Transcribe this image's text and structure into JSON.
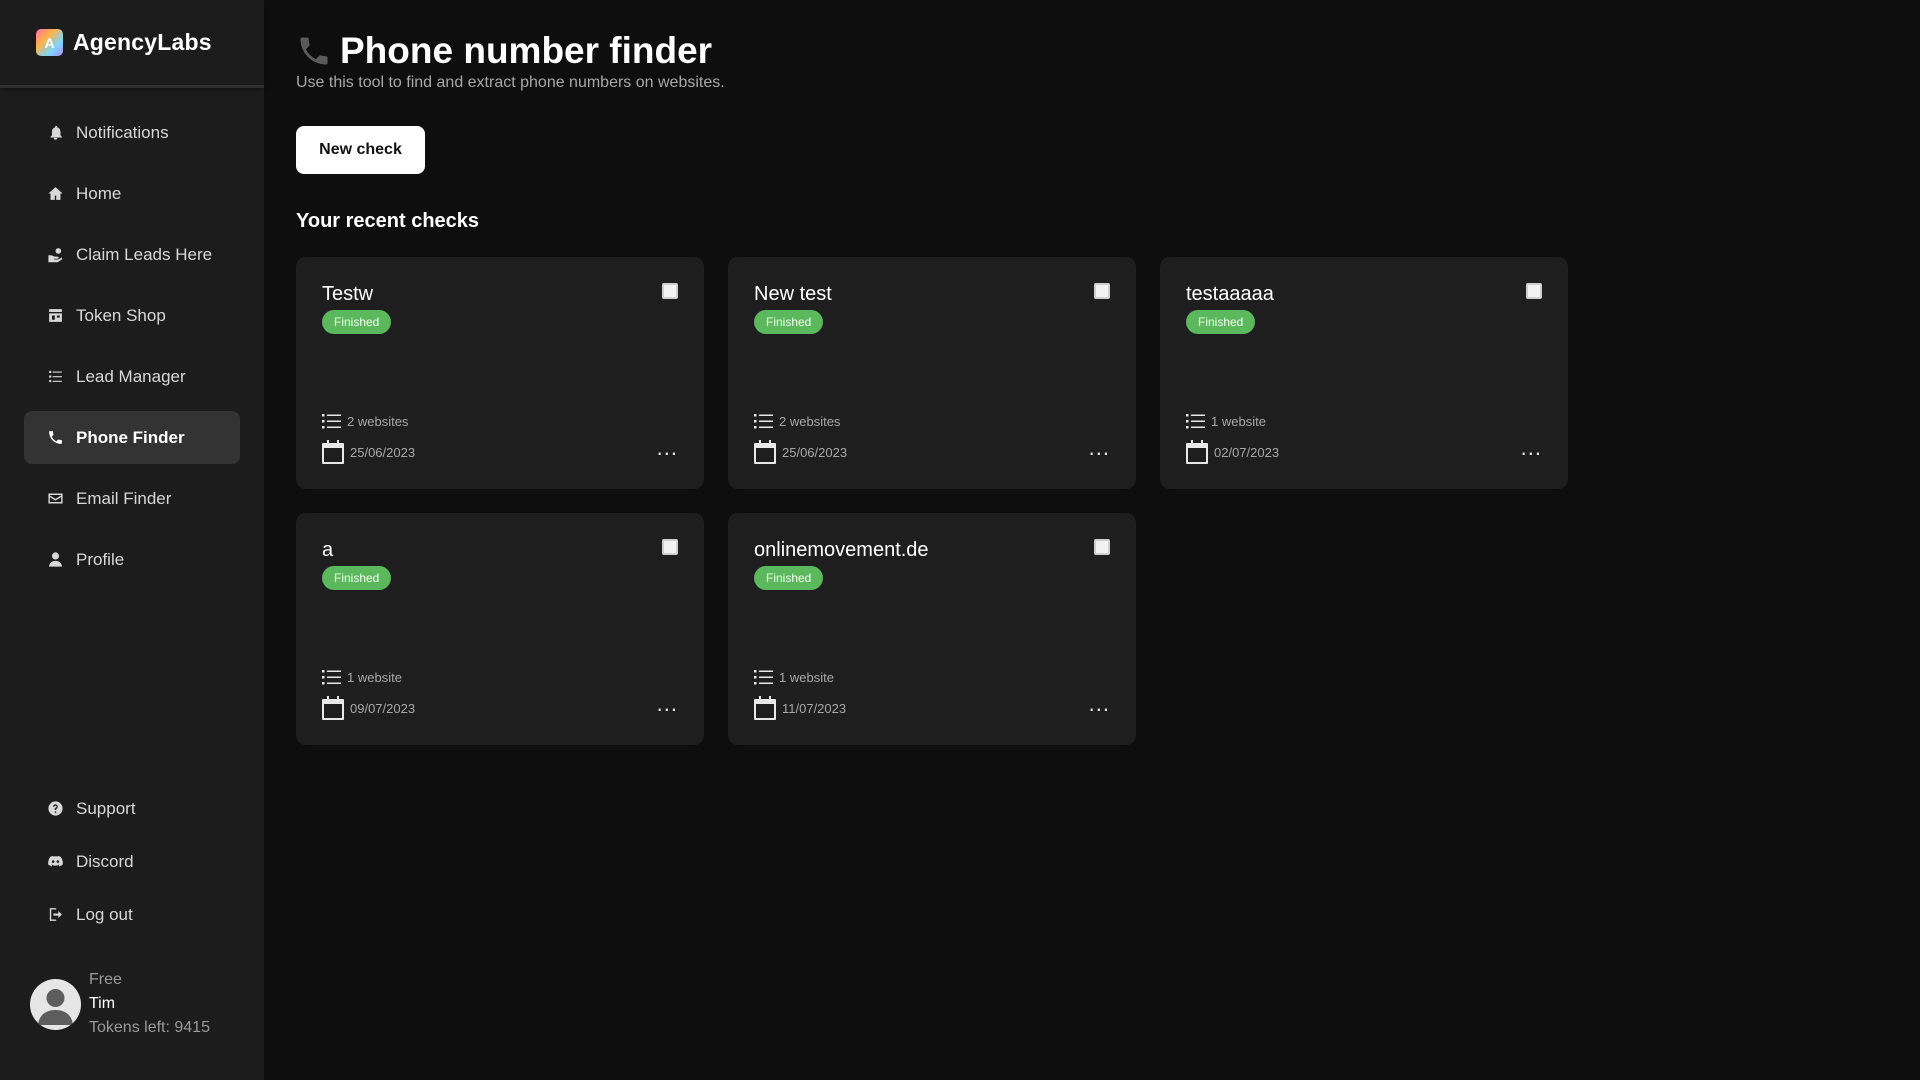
{
  "brand": {
    "name": "AgencyLabs",
    "logo_letter": "A"
  },
  "sidebar": {
    "items": [
      {
        "label": "Notifications",
        "icon": "bell-icon"
      },
      {
        "label": "Home",
        "icon": "home-icon"
      },
      {
        "label": "Claim Leads Here",
        "icon": "hand-coin-icon"
      },
      {
        "label": "Token Shop",
        "icon": "store-icon"
      },
      {
        "label": "Lead Manager",
        "icon": "list-icon"
      },
      {
        "label": "Phone Finder",
        "icon": "phone-icon",
        "active": true
      },
      {
        "label": "Email Finder",
        "icon": "mail-icon"
      },
      {
        "label": "Profile",
        "icon": "user-icon"
      }
    ],
    "bottom_items": [
      {
        "label": "Support",
        "icon": "question-icon"
      },
      {
        "label": "Discord",
        "icon": "discord-icon"
      },
      {
        "label": "Log out",
        "icon": "logout-icon"
      }
    ]
  },
  "user": {
    "plan": "Free",
    "name": "Tim",
    "tokens": "Tokens left: 9415"
  },
  "main": {
    "title": "Phone number finder",
    "subtitle": "Use this tool to find and extract phone numbers on websites.",
    "new_check_label": "New check",
    "section_title": "Your recent checks"
  },
  "cards": [
    {
      "title": "Testw",
      "status": "Finished",
      "websites": "2 websites",
      "date": "25/06/2023"
    },
    {
      "title": "New test",
      "status": "Finished",
      "websites": "2 websites",
      "date": "25/06/2023"
    },
    {
      "title": "testaaaaa",
      "status": "Finished",
      "websites": "1 website",
      "date": "02/07/2023"
    },
    {
      "title": "a",
      "status": "Finished",
      "websites": "1 website",
      "date": "09/07/2023"
    },
    {
      "title": "onlinemovement.de",
      "status": "Finished",
      "websites": "1 website",
      "date": "11/07/2023"
    }
  ],
  "more_label": "...",
  "colors": {
    "background": "#0e0e0e",
    "sidebar": "#1c1c1c",
    "card": "#1e1e1e",
    "badge": "#5cb85c"
  }
}
